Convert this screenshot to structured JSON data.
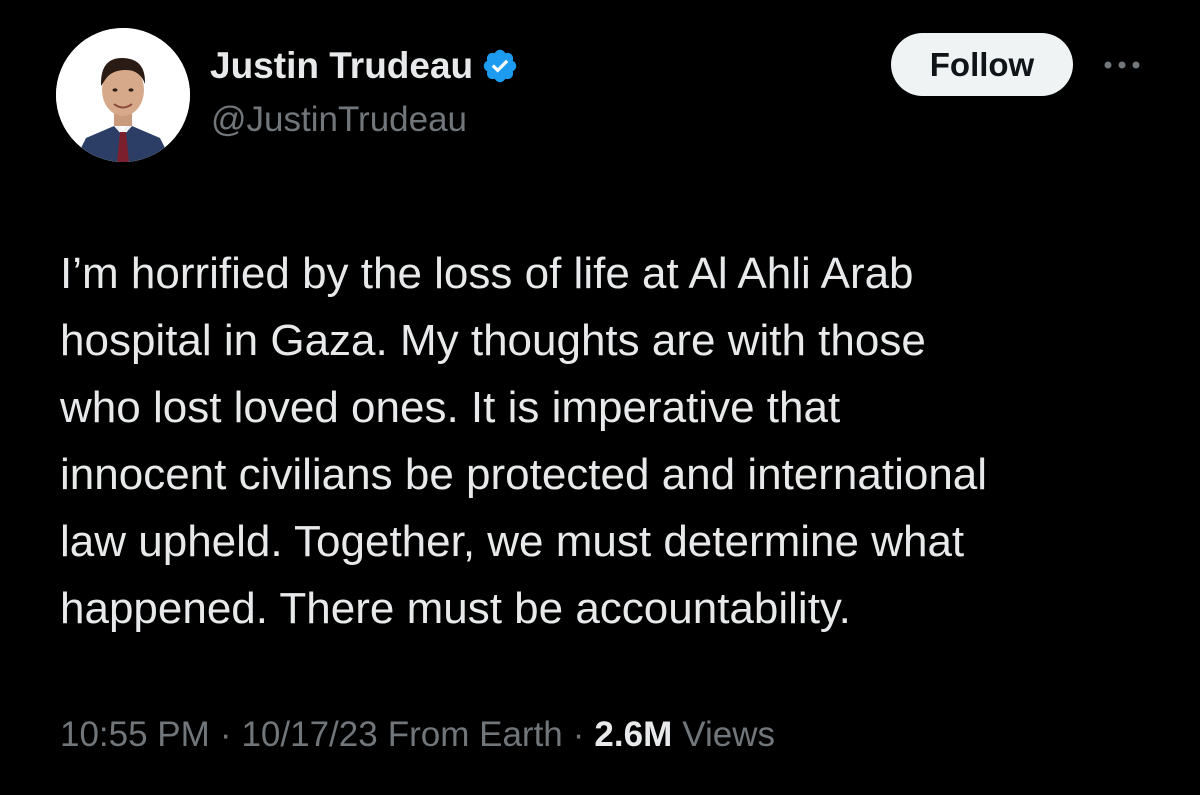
{
  "author": {
    "display_name": "Justin Trudeau",
    "handle": "@JustinTrudeau",
    "verified": true,
    "verified_icon": "verified-badge-icon",
    "avatar": "profile-photo"
  },
  "actions": {
    "follow_label": "Follow",
    "more_icon": "more-options-icon"
  },
  "tweet": {
    "lines": [
      "I’m horrified by the loss of life at Al Ahli Arab",
      "hospital in Gaza. My thoughts are with those",
      "who lost loved ones. It is imperative that",
      "innocent civilians be protected and international",
      "law upheld. Together, we must determine what",
      "happened. There must be accountability."
    ]
  },
  "meta": {
    "time": "10:55 PM",
    "separator": "·",
    "date": "10/17/23",
    "location": "From Earth",
    "views_count": "2.6M",
    "views_label": "Views"
  },
  "colors": {
    "background": "#000000",
    "primary_text": "#e7e9ea",
    "secondary_text": "#71767b",
    "verified_blue": "#1d9bf0",
    "follow_button_bg": "#eff3f4",
    "follow_button_text": "#0f1419"
  }
}
